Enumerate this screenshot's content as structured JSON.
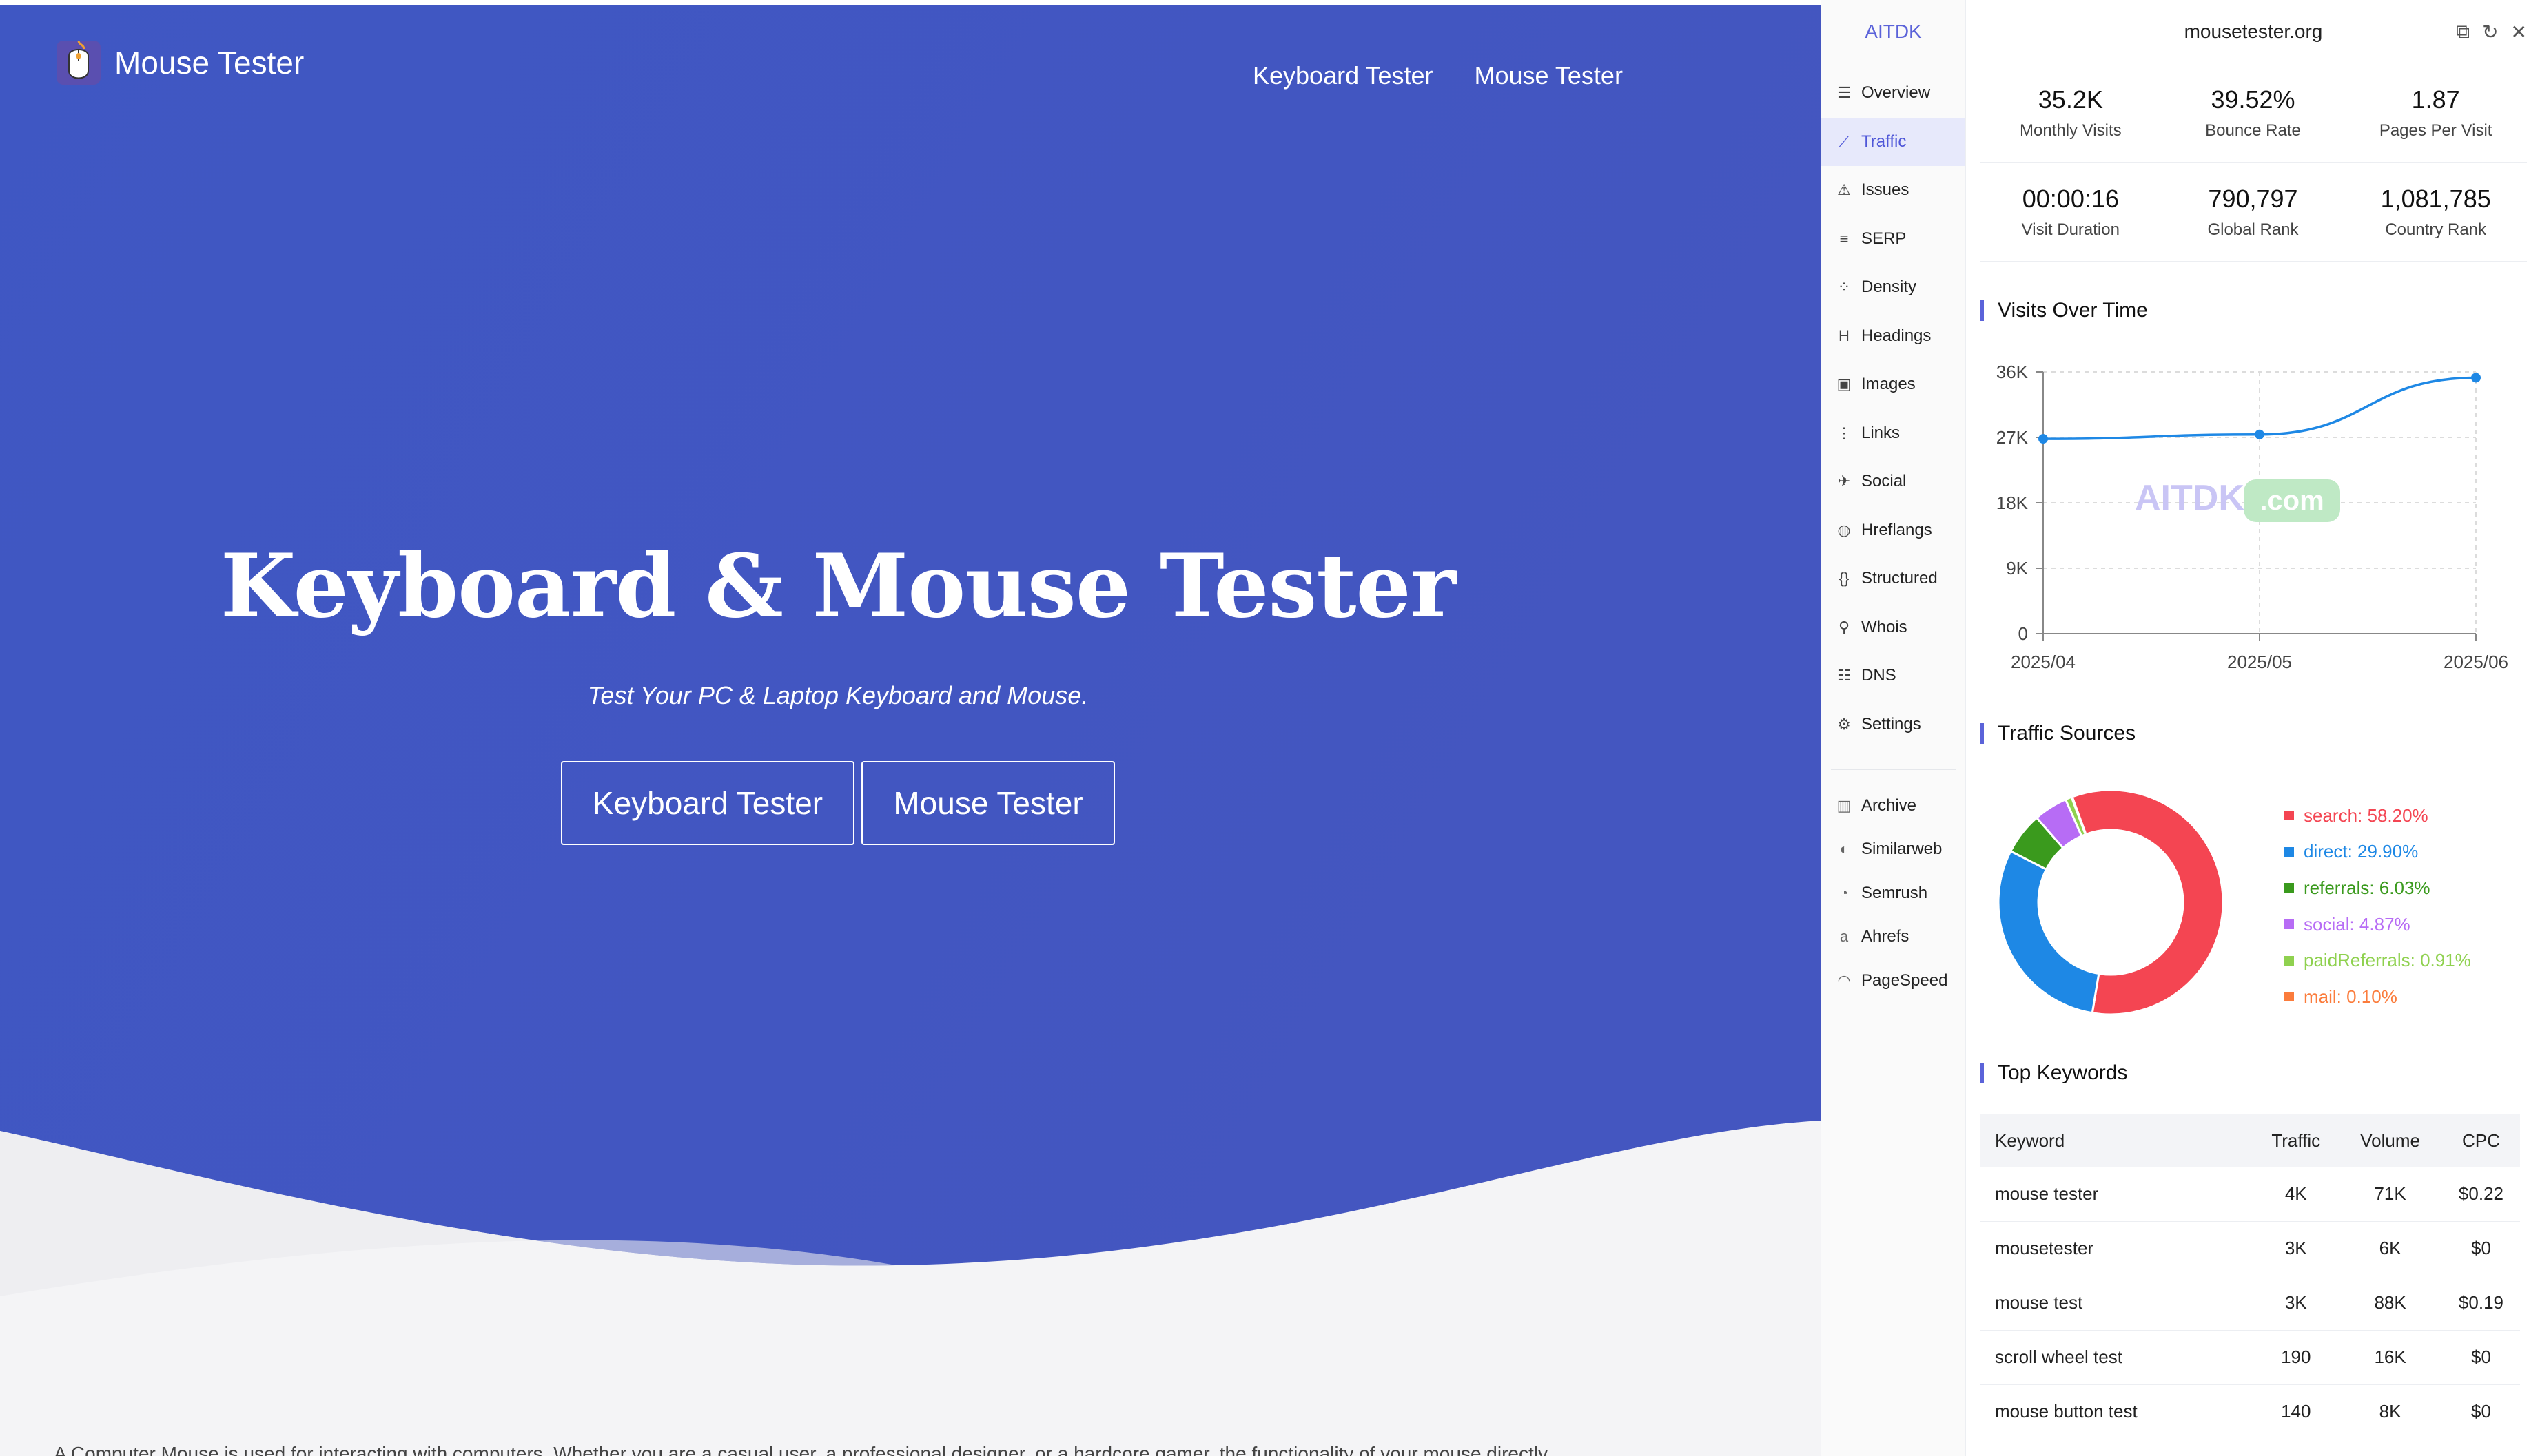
{
  "site": {
    "brand": "Mouse Tester",
    "nav": [
      "Keyboard Tester",
      "Mouse Tester"
    ],
    "hero_title": "Keyboard & Mouse Tester",
    "hero_subtitle": "Test Your PC & Laptop Keyboard and Mouse.",
    "buttons": [
      "Keyboard Tester",
      "Mouse Tester"
    ],
    "intro_text": "A Computer Mouse is used for interacting with computers. Whether you are a casual user, a professional designer, or a hardcore gamer, the functionality of your mouse directly",
    "colors": {
      "hero": "#4356c2",
      "wave": "#f4f4f6"
    }
  },
  "panel": {
    "brand": "AITDK",
    "domain": "mousetester.org",
    "actions": [
      "crop-icon",
      "refresh-icon",
      "close-icon"
    ],
    "nav": [
      {
        "label": "Overview",
        "icon": "overview-icon"
      },
      {
        "label": "Traffic",
        "icon": "chart-line-icon",
        "active": true
      },
      {
        "label": "Issues",
        "icon": "warning-icon"
      },
      {
        "label": "SERP",
        "icon": "serp-icon"
      },
      {
        "label": "Density",
        "icon": "scatter-icon"
      },
      {
        "label": "Headings",
        "icon": "heading-icon"
      },
      {
        "label": "Images",
        "icon": "image-icon"
      },
      {
        "label": "Links",
        "icon": "list-icon"
      },
      {
        "label": "Social",
        "icon": "bird-icon"
      },
      {
        "label": "Hreflangs",
        "icon": "globe-icon"
      },
      {
        "label": "Structured",
        "icon": "braces-icon"
      },
      {
        "label": "Whois",
        "icon": "user-search-icon"
      },
      {
        "label": "DNS",
        "icon": "server-icon"
      },
      {
        "label": "Settings",
        "icon": "gear-icon"
      }
    ],
    "external": [
      {
        "label": "Archive",
        "icon": "archive-icon"
      },
      {
        "label": "Similarweb",
        "icon": "similarweb-icon"
      },
      {
        "label": "Semrush",
        "icon": "semrush-icon"
      },
      {
        "label": "Ahrefs",
        "icon": "ahrefs-icon"
      },
      {
        "label": "PageSpeed",
        "icon": "pagespeed-icon"
      }
    ],
    "stats": [
      {
        "value": "35.2K",
        "label": "Monthly Visits"
      },
      {
        "value": "39.52%",
        "label": "Bounce Rate"
      },
      {
        "value": "1.87",
        "label": "Pages Per Visit"
      },
      {
        "value": "00:00:16",
        "label": "Visit Duration"
      },
      {
        "value": "790,797",
        "label": "Global Rank"
      },
      {
        "value": "1,081,785",
        "label": "Country Rank"
      }
    ],
    "visits_title": "Visits Over Time",
    "watermark": "AITDK .com",
    "sources_title": "Traffic Sources",
    "keywords_title": "Top Keywords",
    "keywords": {
      "columns": [
        "Keyword",
        "Traffic",
        "Volume",
        "CPC"
      ],
      "rows": [
        [
          "mouse tester",
          "4K",
          "71K",
          "$0.22"
        ],
        [
          "mousetester",
          "3K",
          "6K",
          "$0"
        ],
        [
          "mouse test",
          "3K",
          "88K",
          "$0.19"
        ],
        [
          "scroll wheel test",
          "190",
          "16K",
          "$0"
        ],
        [
          "mouse button test",
          "140",
          "8K",
          "$0"
        ]
      ]
    },
    "accent": "#5b63d9"
  },
  "chart_data": [
    {
      "type": "line",
      "x": [
        "2025/04",
        "2025/05",
        "2025/06"
      ],
      "values": [
        26800,
        27400,
        35200
      ],
      "yticks": [
        "0",
        "9K",
        "18K",
        "27K",
        "36K"
      ],
      "ylim": [
        0,
        36000
      ],
      "grid": true,
      "color": "#1e88e5"
    },
    {
      "type": "pie",
      "donut": true,
      "labels": [
        "search",
        "direct",
        "referrals",
        "social",
        "paidReferrals",
        "mail"
      ],
      "values": [
        58.2,
        29.9,
        6.03,
        4.87,
        0.91,
        0.1
      ],
      "display": [
        "search: 58.20%",
        "direct: 29.90%",
        "referrals: 6.03%",
        "social: 4.87%",
        "paidReferrals: 0.91%",
        "mail: 0.10%"
      ],
      "colors": [
        "#f44552",
        "#1e88e5",
        "#3a9a1d",
        "#b76cf5",
        "#8fd14f",
        "#fb7c3c"
      ],
      "legend": "right"
    }
  ]
}
